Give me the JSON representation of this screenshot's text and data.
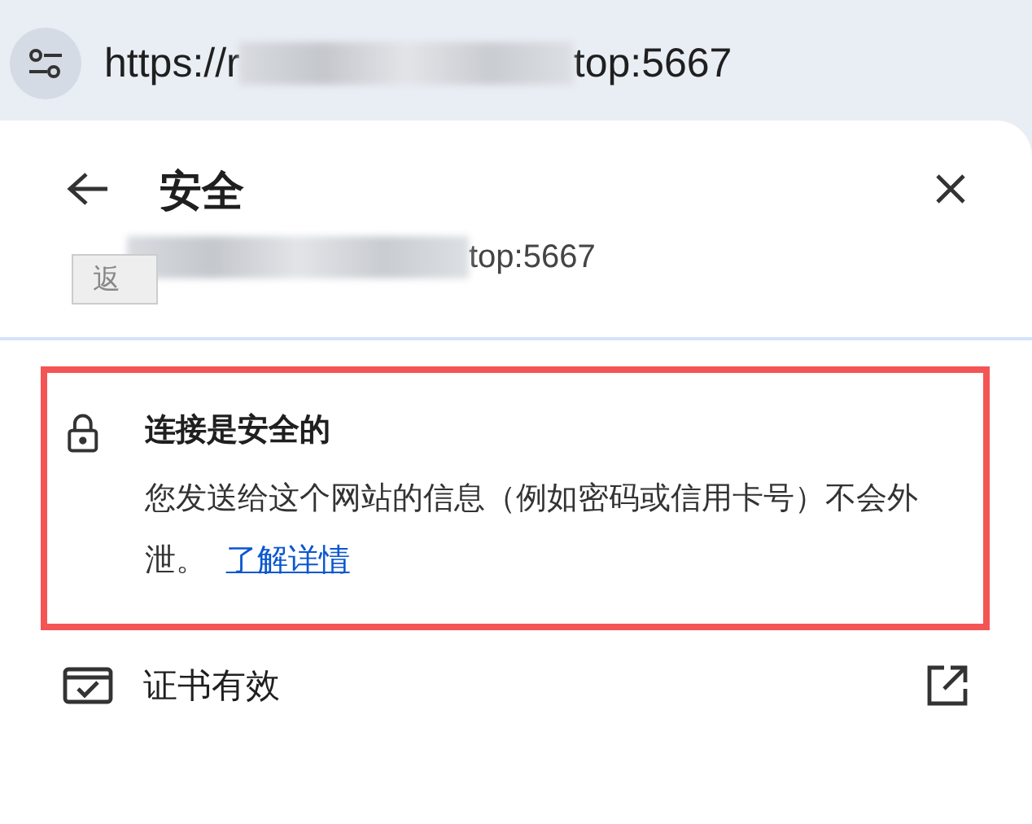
{
  "address_bar": {
    "url_start": "https://r",
    "url_end": "top:5667"
  },
  "popup": {
    "title": "安全",
    "site_end": "top:5667",
    "tooltip": "返",
    "connection": {
      "title": "连接是安全的",
      "description": "您发送给这个网站的信息（例如密码或信用卡号）不会外泄。",
      "link": "了解详情",
      "highlighted": true
    },
    "certificate": {
      "label": "证书有效"
    }
  }
}
